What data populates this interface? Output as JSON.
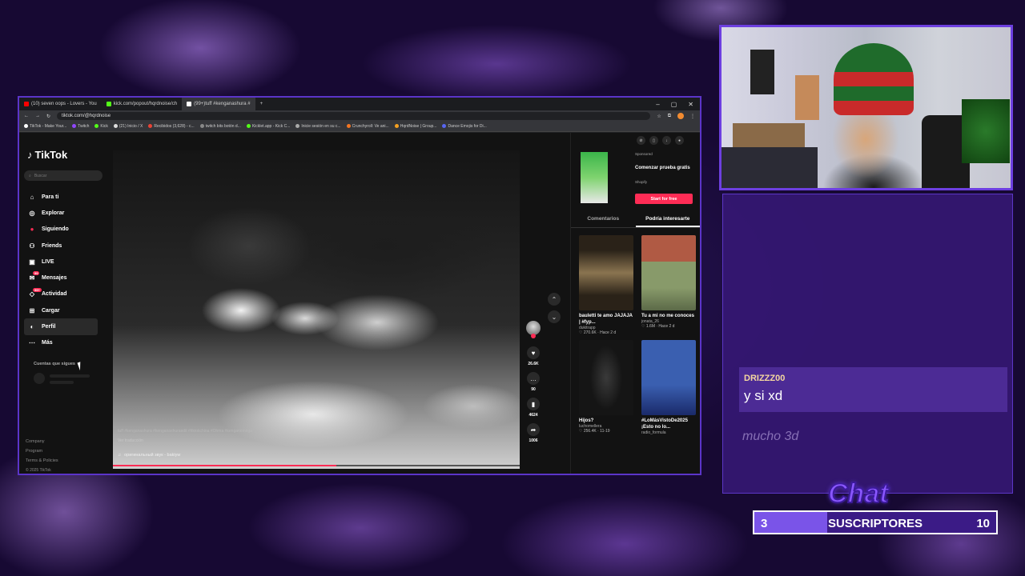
{
  "browser": {
    "tabs": [
      {
        "label": "(10) seven oops - Lovers - You",
        "color": "#ff0000"
      },
      {
        "label": "kick.com/popout/hqrdnoise/ch",
        "color": "#53fc18"
      },
      {
        "label": "(99+)tuff #kenganashura #",
        "color": "#ffffff",
        "active": true
      }
    ],
    "url": "tiktok.com/@hqrdnoise",
    "bookmarks": [
      "TikTok - Make Your...",
      "Twitch",
      "Kick",
      "(21) Inicio / X",
      "Recibidos (3,628) - c...",
      "twitch bits botón d...",
      "Kicklet.app - Kick C...",
      "Inicie sesión en su c...",
      "Crunchyroll: Ve ani...",
      "HqrdNoise | Group...",
      "Dance Emojis for Di..."
    ]
  },
  "tiktok": {
    "logo": "TikTok",
    "search_placeholder": "Buscar",
    "nav": [
      {
        "label": "Para ti",
        "icon": "home-icon",
        "glyph": "⌂"
      },
      {
        "label": "Explorar",
        "icon": "compass-icon",
        "glyph": "◎"
      },
      {
        "label": "Siguiendo",
        "icon": "following-icon",
        "glyph": "●"
      },
      {
        "label": "Friends",
        "icon": "friends-icon",
        "glyph": "⚇"
      },
      {
        "label": "LIVE",
        "icon": "live-icon",
        "glyph": "▣"
      },
      {
        "label": "Mensajes",
        "icon": "messages-icon",
        "glyph": "✉",
        "badge": "99"
      },
      {
        "label": "Actividad",
        "icon": "activity-icon",
        "glyph": "◇",
        "badge": "99+"
      },
      {
        "label": "Cargar",
        "icon": "upload-icon",
        "glyph": "⊞"
      },
      {
        "label": "Perfil",
        "icon": "profile-icon",
        "glyph": "◐",
        "active": true
      },
      {
        "label": "Más",
        "icon": "more-icon",
        "glyph": "⋯"
      }
    ],
    "following_title": "Cuentas que sigues",
    "footer": [
      "Company",
      "Program",
      "Terms & Policies"
    ],
    "copyright": "© 2025 TikTok",
    "video": {
      "caption": "tuff #kenganashura #kenganashuraedit #tiktokchina #Ohma #kenganomega",
      "more_label": "Ver traducción",
      "sound": "оригинальный звук - bakiyw",
      "progress": 0.55
    },
    "actions": [
      {
        "icon": "heart-icon",
        "glyph": "♥",
        "count": "26.6K"
      },
      {
        "icon": "comment-icon",
        "glyph": "…",
        "count": "90"
      },
      {
        "icon": "bookmark-icon",
        "glyph": "▮",
        "count": "4624"
      },
      {
        "icon": "share-icon",
        "glyph": "➦",
        "count": "1006"
      }
    ],
    "ad": {
      "sponsored": "Sponsored",
      "title": "Comenzar prueba gratis",
      "brand": "Shopify",
      "cta": "Start for free"
    },
    "right_tabs": [
      "Comentarios",
      "Podría interesarte"
    ],
    "recommendations": [
      {
        "title": "bauletti te amo JAJAJA | #fyp...",
        "user": "dukitrapp",
        "meta": "♡ 270.6K · Hace 2 d",
        "thumb": "#6b5a3f"
      },
      {
        "title": "Tu a mi no me conoces",
        "user": "jonata_26",
        "meta": "♡ 1.6M · Hace 2 d",
        "thumb": "#8a4e3a"
      },
      {
        "title": "Hijos?",
        "user": "luchomellera",
        "meta": "♡ 256.4K · 11-19",
        "thumb": "#2a2a2a"
      },
      {
        "title": "#LoMásVistoDe2025 ¡Esto no lo...",
        "user": "radio_formula",
        "meta": "",
        "thumb": "#3a5a9a"
      }
    ]
  },
  "chat": {
    "title": "Chat",
    "messages": [
      {
        "user": "DRIZZZ00",
        "text": "y si xd"
      },
      {
        "user": "",
        "text": "mucho 3d"
      }
    ],
    "subs": {
      "label": "SUSCRIPTORES",
      "current": "3",
      "goal": "10",
      "fraction": 0.3
    }
  }
}
